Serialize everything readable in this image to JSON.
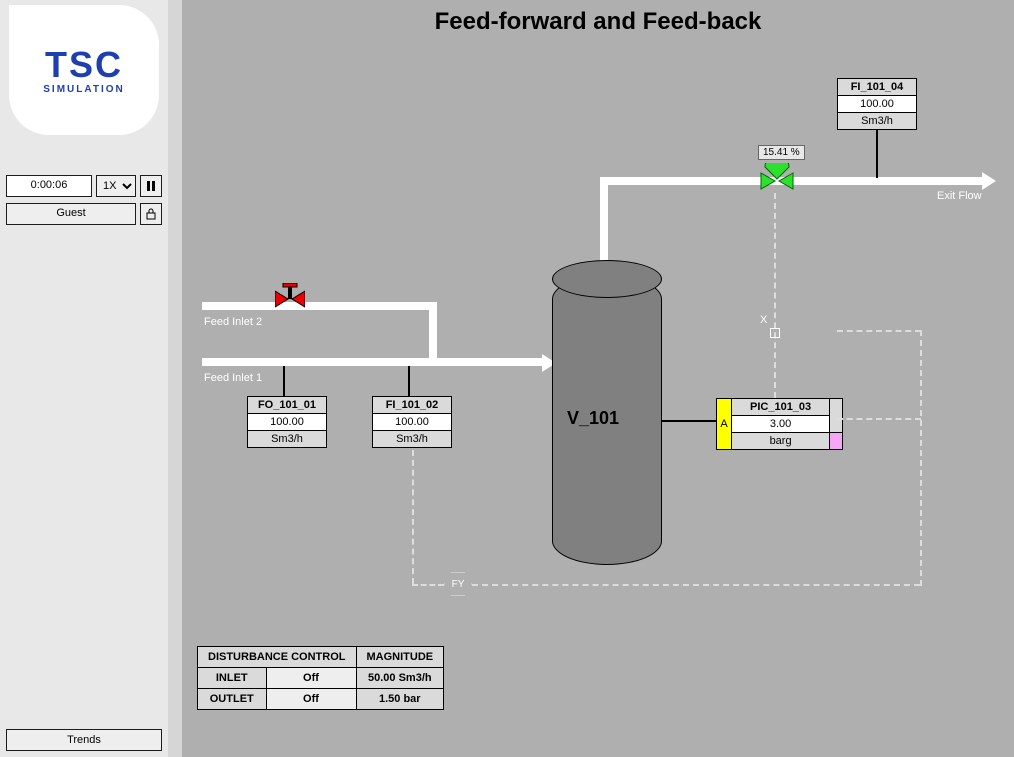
{
  "title": "Feed-forward and Feed-back",
  "sidebar": {
    "logo_top": "TSC",
    "logo_bottom": "SIMULATION",
    "time": "0:00:06",
    "speed_options": [
      "1X"
    ],
    "speed": "1X",
    "user": "Guest",
    "trends": "Trends"
  },
  "labels": {
    "feed1": "Feed Inlet 1",
    "feed2": "Feed Inlet 2",
    "exit": "Exit Flow",
    "vessel": "V_101",
    "x": "X",
    "fy": "FY",
    "pic_a": "A"
  },
  "valve": {
    "percent": "15.41 %"
  },
  "tags": {
    "fo_101_01": {
      "name": "FO_101_01",
      "value": "100.00",
      "unit": "Sm3/h"
    },
    "fi_101_02": {
      "name": "FI_101_02",
      "value": "100.00",
      "unit": "Sm3/h"
    },
    "fi_101_04": {
      "name": "FI_101_04",
      "value": "100.00",
      "unit": "Sm3/h"
    },
    "pic_101_03": {
      "name": "PIC_101_03",
      "value": "3.00",
      "unit": "barg"
    }
  },
  "disturbance": {
    "hdr1": "DISTURBANCE CONTROL",
    "hdr2": "MAGNITUDE",
    "row1_lbl": "INLET",
    "row1_state": "Off",
    "row1_mag": "50.00 Sm3/h",
    "row2_lbl": "OUTLET",
    "row2_state": "Off",
    "row2_mag": "1.50 bar"
  }
}
